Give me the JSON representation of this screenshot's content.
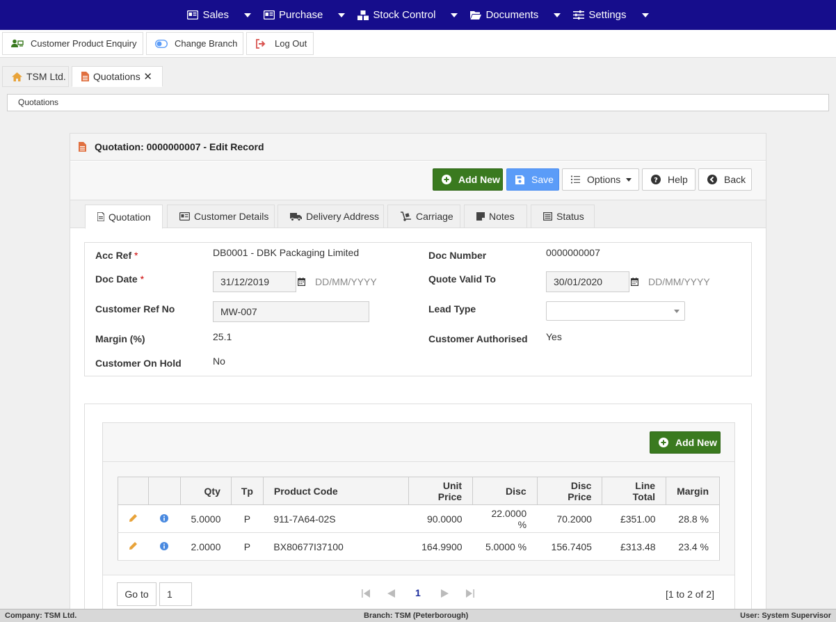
{
  "nav": [
    {
      "label": "Sales",
      "icon": "id-card-icon"
    },
    {
      "label": "Purchase",
      "icon": "id-card-icon"
    },
    {
      "label": "Stock Control",
      "icon": "cubes-icon"
    },
    {
      "label": "Documents",
      "icon": "folder-open-icon"
    },
    {
      "label": "Settings",
      "icon": "sliders-icon"
    }
  ],
  "toolbar": {
    "enquiry": "Customer Product Enquiry",
    "branch": "Change Branch",
    "logout": "Log Out"
  },
  "tabs": [
    {
      "label": "TSM Ltd."
    },
    {
      "label": "Quotations"
    }
  ],
  "breadcrumb": "Quotations",
  "panel": {
    "title": "Quotation: 0000000007 - Edit Record",
    "add_new": "Add New",
    "save": "Save",
    "options": "Options",
    "help": "Help",
    "back": "Back"
  },
  "subtabs": [
    "Quotation",
    "Customer Details",
    "Delivery Address",
    "Carriage",
    "Notes",
    "Status"
  ],
  "form": {
    "acc_ref_label": "Acc Ref",
    "acc_ref": "DB0001 - DBK Packaging Limited",
    "doc_number_label": "Doc Number",
    "doc_number": "0000000007",
    "doc_date_label": "Doc Date",
    "doc_date": "31/12/2019",
    "date_placeholder": "DD/MM/YYYY",
    "quote_valid_label": "Quote Valid To",
    "quote_valid": "30/01/2020",
    "cust_ref_label": "Customer Ref No",
    "cust_ref": "MW-007",
    "lead_type_label": "Lead Type",
    "lead_type": "",
    "margin_label": "Margin (%)",
    "margin": "25.1",
    "cust_auth_label": "Customer Authorised",
    "cust_auth": "Yes",
    "on_hold_label": "Customer On Hold",
    "on_hold": "No",
    "required_mark": "*"
  },
  "lines": {
    "add_new": "Add New",
    "headers": [
      "Qty",
      "Tp",
      "Product Code",
      "Unit Price",
      "Disc",
      "Disc Price",
      "Line Total",
      "Margin"
    ],
    "rows": [
      [
        "5.0000",
        "P",
        "911-7A64-02S",
        "90.0000",
        "22.0000 %",
        "70.2000",
        "£351.00",
        "28.8 %"
      ],
      [
        "2.0000",
        "P",
        "BX80677I37100",
        "164.9900",
        "5.0000 %",
        "156.7405",
        "£313.48",
        "23.4 %"
      ]
    ],
    "goto": "Go to",
    "page_input": "1",
    "current_page": "1",
    "info": "[1 to 2 of 2]"
  },
  "status": {
    "company": "Company: TSM Ltd.",
    "branch": "Branch: TSM (Peterborough)",
    "user": "User: System Supervisor"
  },
  "colors": {
    "nav_bg": "#160d8c",
    "green": "#3a7a1f",
    "blue": "#5b9cf8",
    "accent_orange": "#e07040"
  }
}
